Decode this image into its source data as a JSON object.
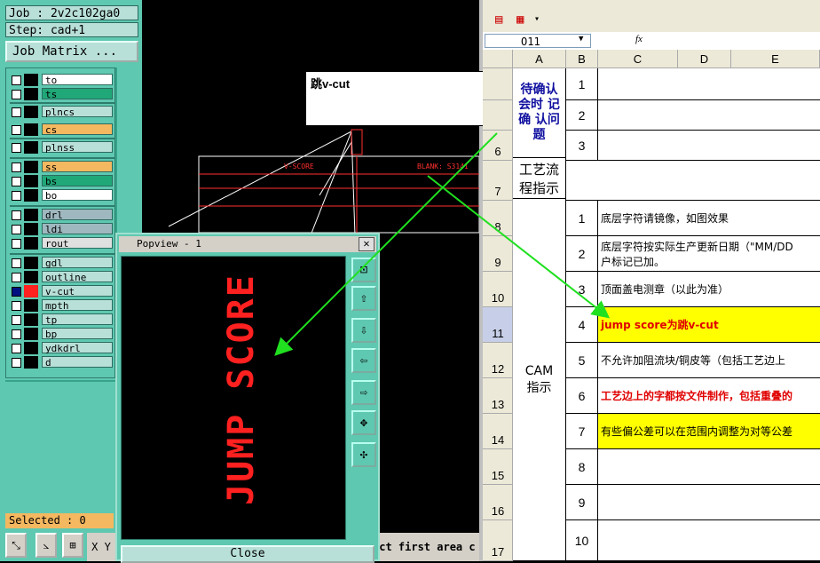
{
  "cam": {
    "job": "Job : 2v2c102ga0",
    "step": "Step: cad+1",
    "job_matrix": "Job Matrix ...",
    "selected": "Selected : 0",
    "xy": "X Y",
    "status": "ect first area c",
    "layers": [
      {
        "name": "to",
        "color": "#ffffff"
      },
      {
        "name": "ts",
        "color": "#20a878"
      },
      {
        "name": "plncs",
        "color": "#b8e0d8"
      },
      {
        "name": "cs",
        "color": "#f4b860"
      },
      {
        "name": "plnss",
        "color": "#b8e0d8"
      },
      {
        "name": "ss",
        "color": "#f4b860"
      },
      {
        "name": "bs",
        "color": "#20a878"
      },
      {
        "name": "bo",
        "color": "#ffffff"
      },
      {
        "name": "drl",
        "color": "#9fb8c0"
      },
      {
        "name": "ldi",
        "color": "#9fb8c0"
      },
      {
        "name": "rout",
        "color": "#e0e0e0"
      },
      {
        "name": "gdl",
        "color": "#b8e0d8"
      },
      {
        "name": "outline",
        "color": "#b8e0d8"
      },
      {
        "name": "v-cut",
        "color": "#b8e0d8"
      },
      {
        "name": "mpth",
        "color": "#b8e0d8"
      },
      {
        "name": "tp",
        "color": "#b8e0d8"
      },
      {
        "name": "bp",
        "color": "#b8e0d8"
      },
      {
        "name": "ydkdrl",
        "color": "#b8e0d8"
      },
      {
        "name": "d",
        "color": "#b8e0d8"
      }
    ]
  },
  "graphic": {
    "vscore_label": "V-SCORE",
    "blank_label": "BLANK: S3141"
  },
  "note": {
    "text": "跳v-cut"
  },
  "popview": {
    "title": "Popview - 1",
    "content": "JUMP SCORE",
    "close_label": "Close"
  },
  "excel": {
    "namebox": "O11",
    "fx": "fx",
    "columns": [
      "A",
      "B",
      "C",
      "D",
      "E"
    ],
    "section_top_text": "待确认 会时 记确 认问题",
    "process_label": "工艺流程指示",
    "cam_label": "CAM 指示",
    "rows": [
      {
        "row": "",
        "num": "1",
        "text": "",
        "bg": "#ffffff",
        "color": "#000000"
      },
      {
        "row": "",
        "num": "2",
        "text": "",
        "bg": "#ffffff",
        "color": "#000000"
      },
      {
        "row": "6",
        "num": "3",
        "text": "",
        "bg": "#ffffff",
        "color": "#000000"
      },
      {
        "row": "7",
        "num": "",
        "text": "",
        "bg": "#ffffff",
        "color": "#000000"
      },
      {
        "row": "8",
        "num": "1",
        "text": "底层字符请镜像，如图效果",
        "bg": "#ffffff",
        "color": "#000000"
      },
      {
        "row": "9",
        "num": "2",
        "text": "底层字符按实际生产更新日期（\"MM/DD",
        "text2": "户标记已加。",
        "bg": "#ffffff",
        "color": "#000000"
      },
      {
        "row": "10",
        "num": "3",
        "text": "顶面盖电测章（以此为准）",
        "bg": "#ffffff",
        "color": "#000000"
      },
      {
        "row": "11",
        "num": "4",
        "text": "jump score为跳v-cut",
        "bg": "#ffff00",
        "color": "#e00000"
      },
      {
        "row": "12",
        "num": "5",
        "text": "不允许加阻流块/铜皮等（包括工艺边上",
        "bg": "#ffffff",
        "color": "#000000"
      },
      {
        "row": "13",
        "num": "6",
        "text": "工艺边上的字都按文件制作，包括重叠的",
        "bg": "#ffffff",
        "color": "#e00000"
      },
      {
        "row": "14",
        "num": "7",
        "text": "有些偏公差可以在范围内调整为对等公差",
        "bg": "#ffff00",
        "color": "#000000"
      },
      {
        "row": "15",
        "num": "8",
        "text": "",
        "bg": "#ffffff",
        "color": "#000000"
      },
      {
        "row": "16",
        "num": "9",
        "text": "",
        "bg": "#ffffff",
        "color": "#000000"
      },
      {
        "row": "17",
        "num": "10",
        "text": "",
        "bg": "#ffffff",
        "color": "#000000"
      }
    ]
  }
}
